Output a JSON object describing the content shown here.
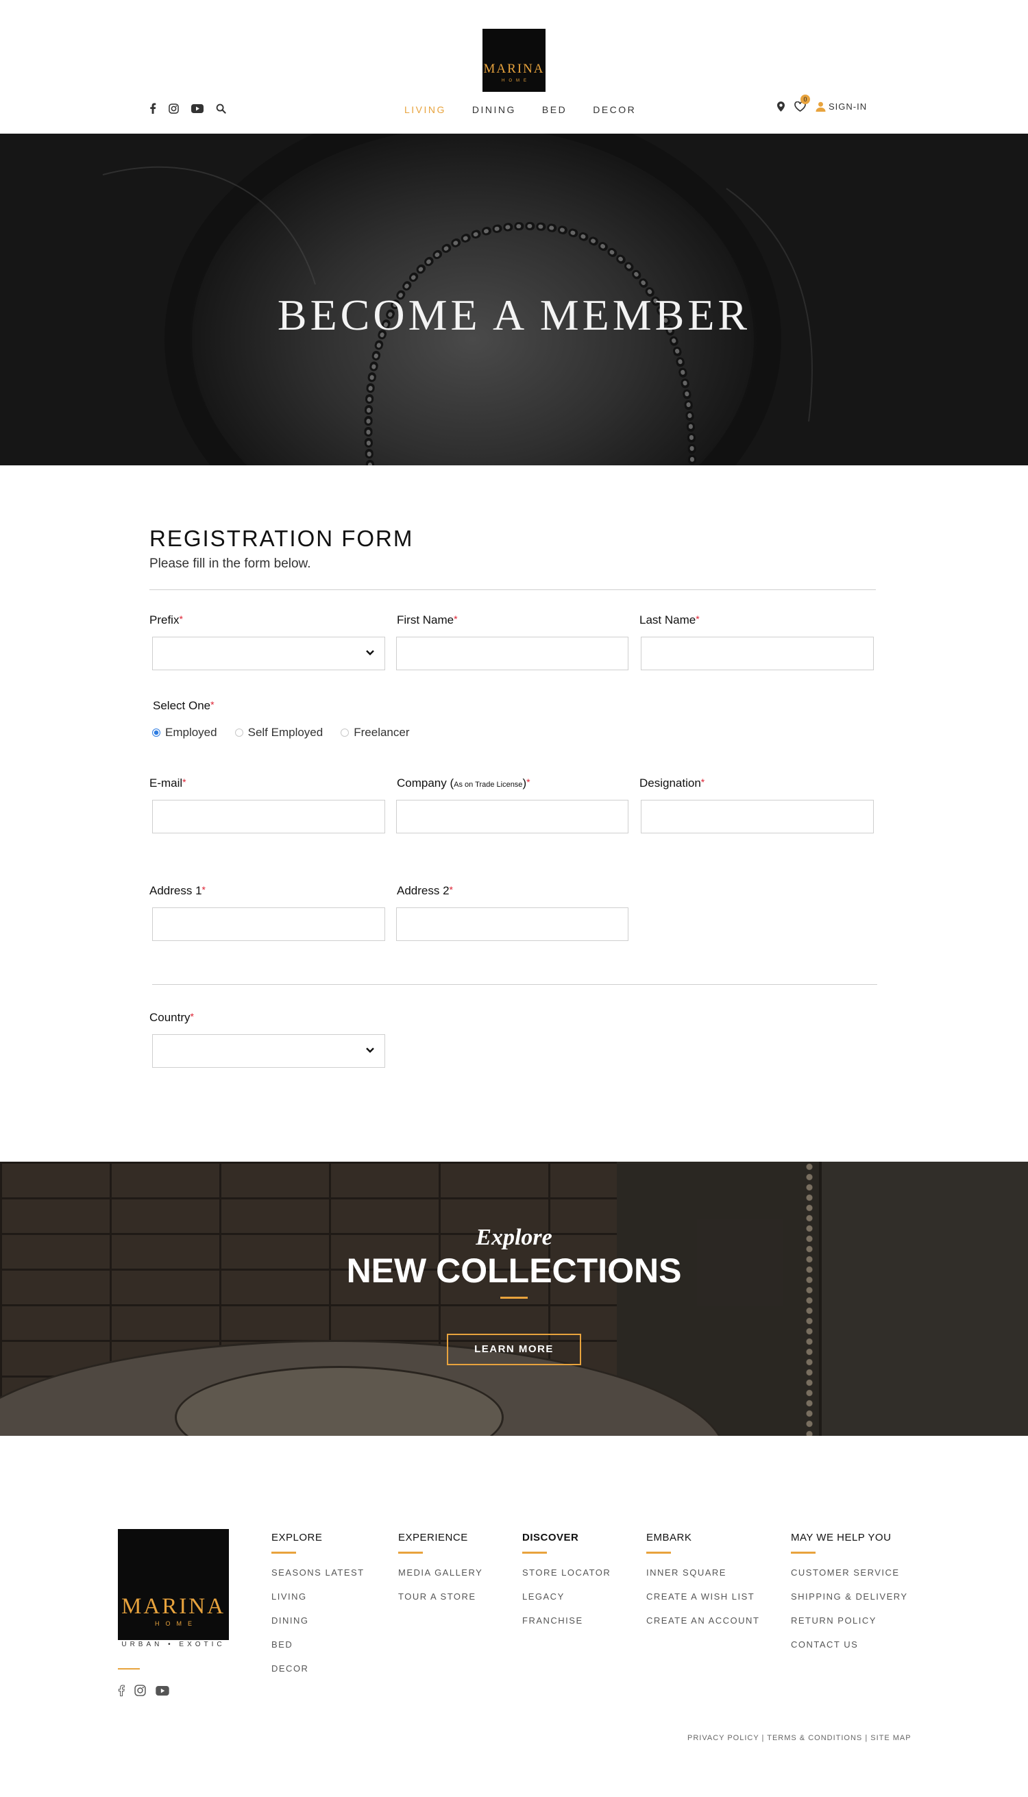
{
  "header": {
    "logo": {
      "brand": "MARINA",
      "sub": "HOME"
    },
    "social": [
      "facebook-icon",
      "instagram-icon",
      "youtube-icon",
      "search-icon"
    ],
    "nav": [
      {
        "label": "LIVING",
        "active": true
      },
      {
        "label": "DINING",
        "active": false
      },
      {
        "label": "BED",
        "active": false
      },
      {
        "label": "DECOR",
        "active": false
      }
    ],
    "wishlist_count": "0",
    "signin_label": "SIGN-IN"
  },
  "hero": {
    "title": "BECOME A MEMBER"
  },
  "form": {
    "title": "REGISTRATION FORM",
    "subtitle": "Please fill in the form below.",
    "required_mark": "*",
    "prefix_label": "Prefix",
    "first_name_label": "First Name",
    "last_name_label": "Last Name",
    "select_one_label": "Select One",
    "radios": [
      {
        "label": "Employed",
        "checked": true
      },
      {
        "label": "Self Employed",
        "checked": false
      },
      {
        "label": "Freelancer",
        "checked": false
      }
    ],
    "email_label": "E-mail",
    "company_label": "Company (",
    "company_note": "As on Trade License",
    "company_close": ")",
    "designation_label": "Designation",
    "address1_label": "Address 1",
    "address2_label": "Address 2",
    "country_label": "Country"
  },
  "promo": {
    "kicker": "Explore",
    "title": "NEW COLLECTIONS",
    "button": "LEARN MORE"
  },
  "footer": {
    "logo": {
      "brand": "MARINA",
      "sub": "HOME"
    },
    "tagline": "URBAN • EXOTIC",
    "columns": [
      {
        "title": "EXPLORE",
        "links": [
          "SEASONS LATEST",
          "LIVING",
          "DINING",
          "BED",
          "DECOR"
        ]
      },
      {
        "title": "EXPERIENCE",
        "links": [
          "MEDIA GALLERY",
          "TOUR A STORE"
        ]
      },
      {
        "title": "DISCOVER",
        "links": [
          "STORE LOCATOR",
          "LEGACY",
          "FRANCHISE"
        ]
      },
      {
        "title": "EMBARK",
        "links": [
          "INNER SQUARE",
          "CREATE A WISH LIST",
          "CREATE AN ACCOUNT"
        ]
      },
      {
        "title": "MAY WE HELP YOU",
        "links": [
          "CUSTOMER SERVICE",
          "SHIPPING & DELIVERY",
          "RETURN POLICY",
          "CONTACT US"
        ]
      }
    ],
    "legal": "PRIVACY POLICY | TERMS & CONDITIONS | SITE MAP"
  },
  "colors": {
    "accent": "#e8a33d",
    "required": "#dd2233",
    "radio_on": "#2f7de1"
  }
}
